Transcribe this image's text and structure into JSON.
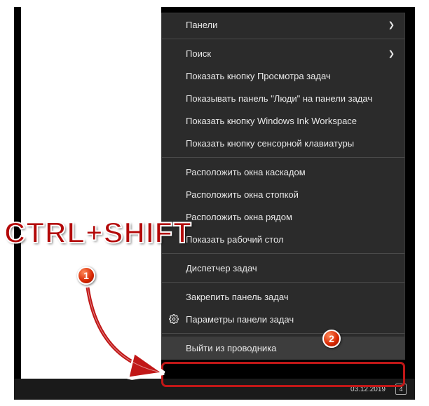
{
  "menu": {
    "items": [
      {
        "label": "Панели",
        "submenu": true
      },
      {
        "label": "Поиск",
        "submenu": true
      },
      {
        "label": "Показать кнопку Просмотра задач"
      },
      {
        "label": "Показывать панель \"Люди\" на панели задач"
      },
      {
        "label": "Показать кнопку Windows Ink Workspace"
      },
      {
        "label": "Показать кнопку сенсорной клавиатуры"
      },
      {
        "label": "Расположить окна каскадом"
      },
      {
        "label": "Расположить окна стопкой"
      },
      {
        "label": "Расположить окна рядом"
      },
      {
        "label": "Показать рабочий стол"
      },
      {
        "label": "Диспетчер задач"
      },
      {
        "label": "Закрепить панель задач"
      },
      {
        "label": "Параметры панели задач",
        "icon": "gear"
      },
      {
        "label": "Выйти из проводника"
      }
    ]
  },
  "annotation": {
    "hotkey": "CTRL+SHIFT",
    "badge1": "1",
    "badge2": "2"
  },
  "tray": {
    "date": "03.12.2019",
    "notif": "4"
  }
}
